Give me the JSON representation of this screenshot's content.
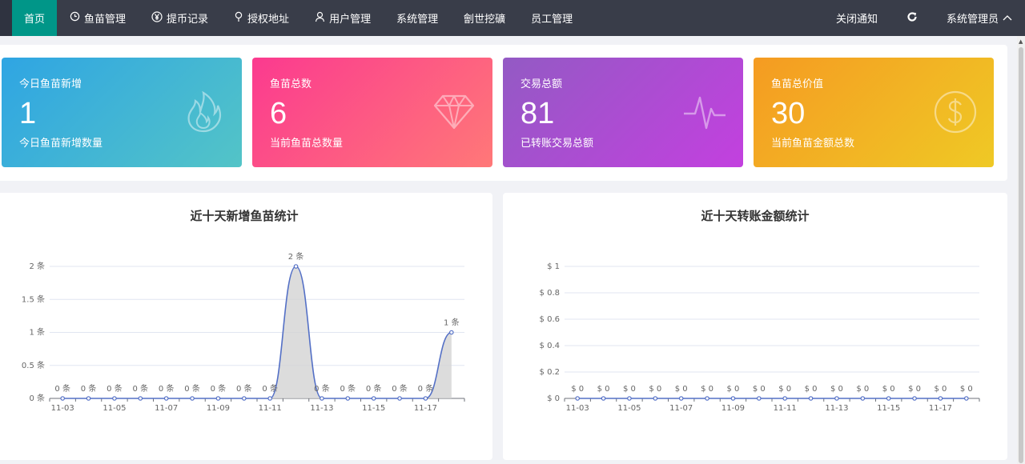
{
  "nav": {
    "items": [
      {
        "label": "首页",
        "icon": ""
      },
      {
        "label": "鱼苗管理",
        "icon": "clock-icon"
      },
      {
        "label": "提币记录",
        "icon": "yen-icon"
      },
      {
        "label": "授权地址",
        "icon": "location-icon"
      },
      {
        "label": "用户管理",
        "icon": "user-icon"
      },
      {
        "label": "系统管理",
        "icon": ""
      },
      {
        "label": "劊世挖礦",
        "icon": ""
      },
      {
        "label": "员工管理",
        "icon": ""
      }
    ],
    "close_notice": "关闭通知",
    "admin": "系统管理员"
  },
  "cards": [
    {
      "title": "今日鱼苗新增",
      "value": "1",
      "desc": "今日鱼苗新增数量",
      "icon": "flame-icon"
    },
    {
      "title": "鱼苗总数",
      "value": "6",
      "desc": "当前鱼苗总数量",
      "icon": "diamond-icon"
    },
    {
      "title": "交易总额",
      "value": "81",
      "desc": "已转账交易总额",
      "icon": "pulse-icon"
    },
    {
      "title": "鱼苗总价值",
      "value": "30",
      "desc": "当前鱼苗金额总数",
      "icon": "dollar-icon"
    }
  ],
  "chart_data": [
    {
      "type": "area",
      "title": "近十天新增鱼苗统计",
      "x": [
        "11-03",
        "11-04",
        "11-05",
        "11-06",
        "11-07",
        "11-08",
        "11-09",
        "11-10",
        "11-11",
        "11-12",
        "11-13",
        "11-14",
        "11-15",
        "11-16",
        "11-17",
        "11-18"
      ],
      "xticks": [
        "11-03",
        "11-05",
        "11-07",
        "11-09",
        "11-11",
        "11-13",
        "11-15",
        "11-17"
      ],
      "values": [
        0,
        0,
        0,
        0,
        0,
        0,
        0,
        0,
        0,
        2,
        0,
        0,
        0,
        0,
        0,
        1
      ],
      "yticks": [
        "0 条",
        "0.5 条",
        "1 条",
        "1.5 条",
        "2 条"
      ],
      "ylim": [
        0,
        2
      ],
      "unit_suffix": " 条",
      "colors": {
        "line": "#5470c6",
        "area": "#d3d3d3"
      }
    },
    {
      "type": "line",
      "title": "近十天转账金额统计",
      "x": [
        "11-03",
        "11-04",
        "11-05",
        "11-06",
        "11-07",
        "11-08",
        "11-09",
        "11-10",
        "11-11",
        "11-12",
        "11-13",
        "11-14",
        "11-15",
        "11-16",
        "11-17",
        "11-18"
      ],
      "xticks": [
        "11-03",
        "11-05",
        "11-07",
        "11-09",
        "11-11",
        "11-13",
        "11-15",
        "11-17"
      ],
      "values": [
        0,
        0,
        0,
        0,
        0,
        0,
        0,
        0,
        0,
        0,
        0,
        0,
        0,
        0,
        0,
        0
      ],
      "yticks": [
        "$ 0",
        "$ 0.2",
        "$ 0.4",
        "$ 0.6",
        "$ 0.8",
        "$ 1"
      ],
      "ylim": [
        0,
        1
      ],
      "unit_prefix": "$ ",
      "colors": {
        "line": "#5470c6"
      }
    }
  ]
}
